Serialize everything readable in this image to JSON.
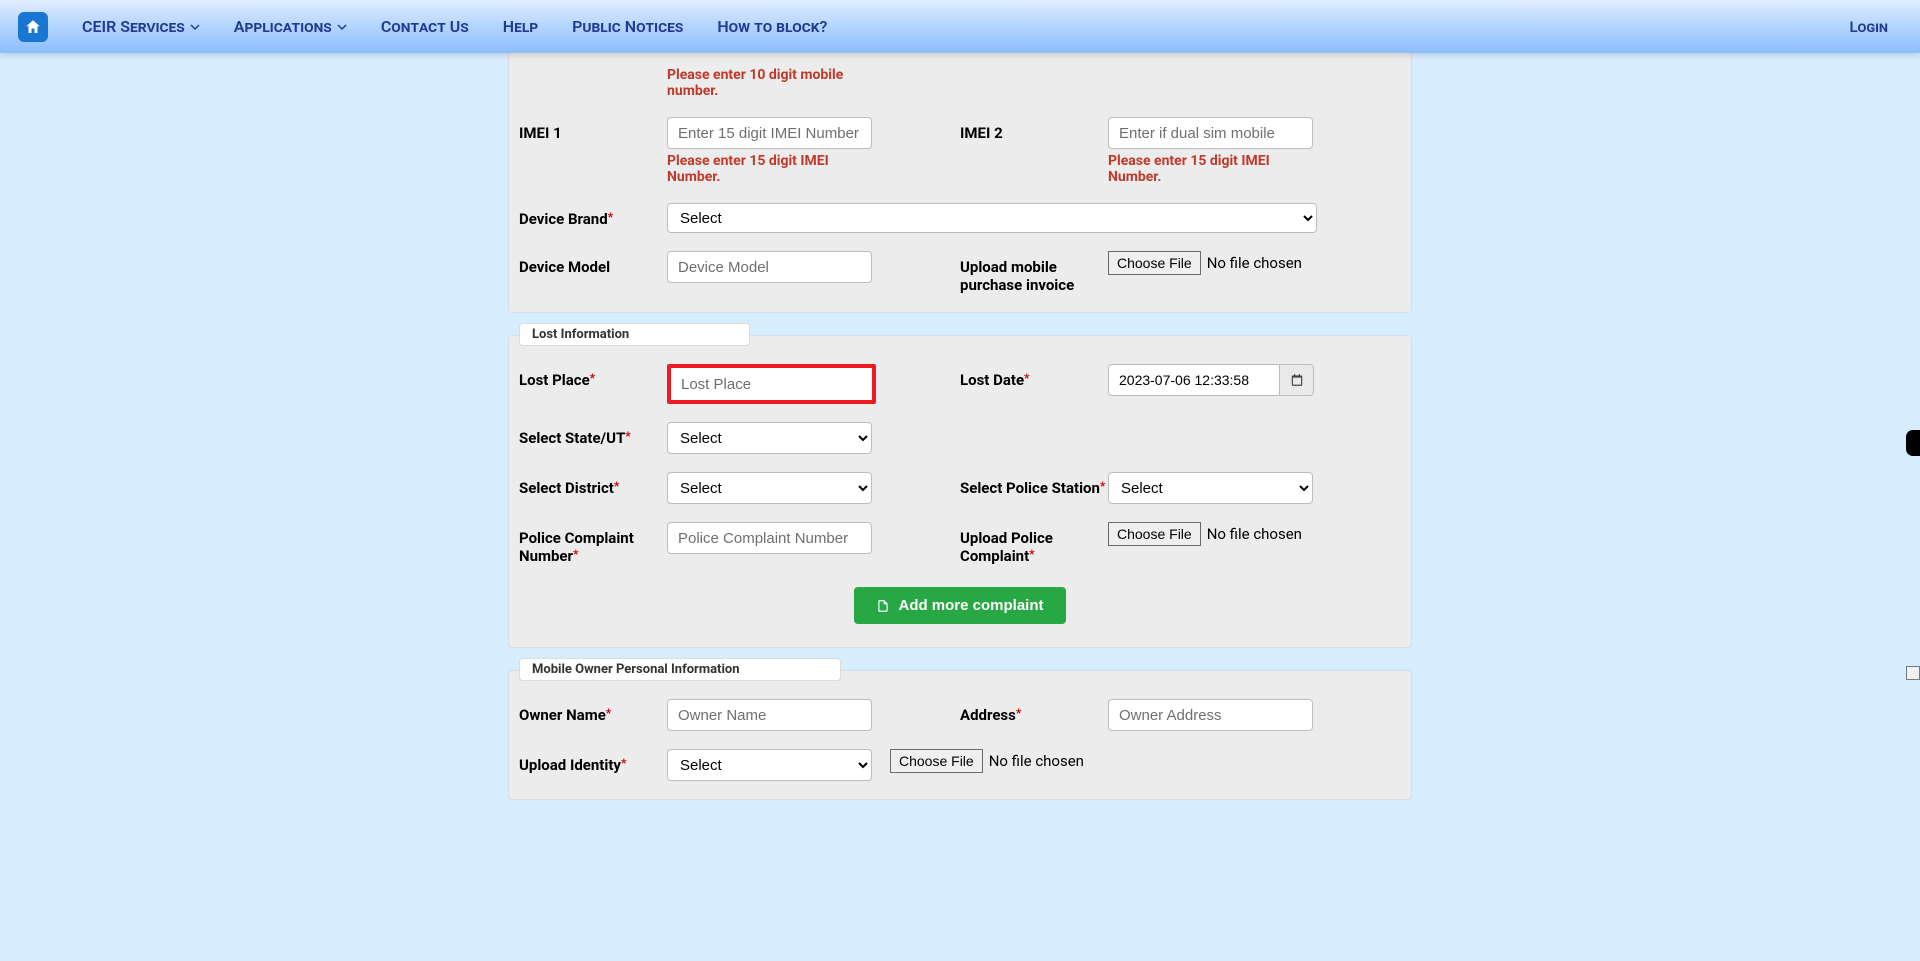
{
  "nav": {
    "ceir_services": "CEIR Services",
    "applications": "Applications",
    "contact_us": "Contact Us",
    "help": "Help",
    "public_notices": "Public Notices",
    "how_to_block": "How to block?",
    "login": "Login"
  },
  "device": {
    "mobile_error": "Please enter 10 digit mobile number.",
    "imei1_label": "IMEI 1",
    "imei1_placeholder": "Enter 15 digit IMEI Number",
    "imei1_error": "Please enter 15 digit IMEI Number.",
    "imei2_label": "IMEI 2",
    "imei2_placeholder": "Enter if dual sim mobile",
    "imei2_error": "Please enter 15 digit IMEI Number.",
    "brand_label": "Device Brand",
    "brand_select": "Select",
    "model_label": "Device Model",
    "model_placeholder": "Device Model",
    "invoice_label": "Upload mobile purchase invoice",
    "choose_file": "Choose File",
    "no_file": "No file chosen"
  },
  "lost": {
    "legend": "Lost Information",
    "place_label": "Lost Place",
    "place_placeholder": "Lost Place",
    "date_label": "Lost Date",
    "date_value": "2023-07-06 12:33:58",
    "state_label": "Select State/UT",
    "state_select": "Select",
    "district_label": "Select District",
    "district_select": "Select",
    "police_station_label": "Select Police Station",
    "police_station_select": "Select",
    "complaint_no_label": "Police Complaint Number",
    "complaint_no_placeholder": "Police Complaint Number",
    "upload_complaint_label": "Upload Police Complaint",
    "choose_file": "Choose File",
    "no_file": "No file chosen",
    "add_more": "Add more complaint"
  },
  "owner": {
    "legend": "Mobile Owner Personal Information",
    "name_label": "Owner Name",
    "name_placeholder": "Owner Name",
    "address_label": "Address",
    "address_placeholder": "Owner Address",
    "identity_label": "Upload Identity",
    "identity_select": "Select",
    "choose_file": "Choose File",
    "no_file": "No file chosen"
  }
}
